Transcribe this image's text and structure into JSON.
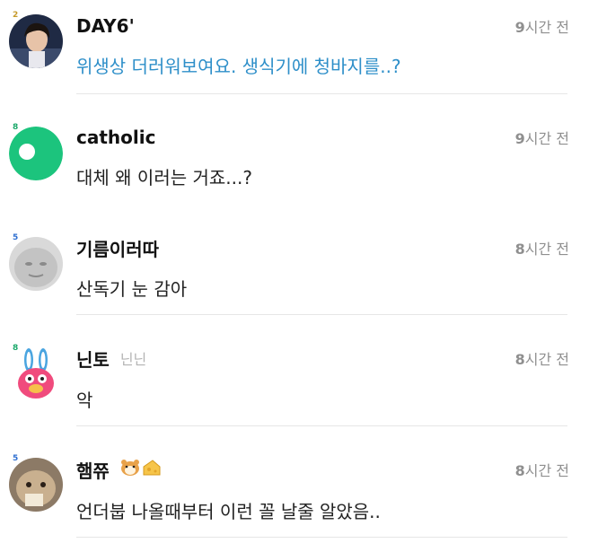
{
  "comments": [
    {
      "level": "2​",
      "level_color": "#c69a2a",
      "username": "DAY6'",
      "subname": "",
      "time_num": "9",
      "time_unit": "시간 전",
      "text": "위생상 더러워보여요. 생식기에 청바지를..?",
      "text_color": "#2e8fc9",
      "avatar": "photo-person-icon"
    },
    {
      "level": "8",
      "level_color": "#1aa86a",
      "username": "catholic",
      "subname": "",
      "time_num": "9",
      "time_unit": "시간 전",
      "text": "대체 왜 이러는 거죠...?",
      "avatar": "green-circle-icon"
    },
    {
      "level": "5",
      "level_color": "#2f6fd0",
      "username": "기름이러따",
      "subname": "",
      "time_num": "8",
      "time_unit": "시간 전",
      "text": "산독기 눈 감아",
      "avatar": "gray-face-icon"
    },
    {
      "level": "8",
      "level_color": "#1aa86a",
      "username": "닌토",
      "subname": "닌닌",
      "time_num": "8",
      "time_unit": "시간 전",
      "text": "악",
      "avatar": "bunny-character-icon"
    },
    {
      "level": "5",
      "level_color": "#2f6fd0",
      "username": "햄쮸",
      "subname": "",
      "time_num": "8",
      "time_unit": "시간 전",
      "text": "언더붑 나올때부터 이런 꼴 날줄 알았음..",
      "avatar": "photo-animal-icon",
      "badges": [
        "hamster-icon",
        "cheese-icon"
      ]
    }
  ]
}
